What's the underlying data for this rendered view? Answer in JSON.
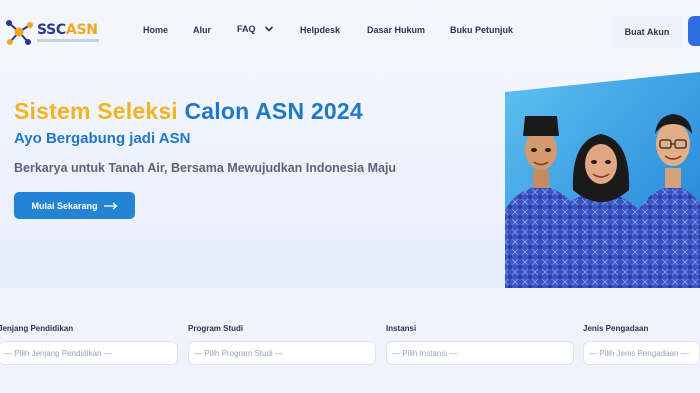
{
  "brand": {
    "ssc": "SSC",
    "asn": "ASN"
  },
  "nav": {
    "home": "Home",
    "alur": "Alur",
    "faq": "FAQ",
    "helpdesk": "Helpdesk",
    "dasar_hukum": "Dasar Hukum",
    "buku_petunjuk": "Buku Petunjuk",
    "buat_akun": "Buat Akun"
  },
  "hero": {
    "title_part1": "Sistem Seleksi",
    "title_part2": "Calon ASN 2024",
    "subtitle": "Ayo Bergabung jadi ASN",
    "tagline": "Berkarya untuk Tanah Air, Bersama Mewujudkan Indonesia Maju",
    "cta": "Mulai Sekarang"
  },
  "filters": [
    {
      "label": "Jenjang Pendidikan",
      "placeholder": "— Pilih Jenjang Pendidikan —"
    },
    {
      "label": "Program Studi",
      "placeholder": "— Pilih Program Studi —"
    },
    {
      "label": "Instansi",
      "placeholder": "— Pilih Instansi —"
    },
    {
      "label": "Jenis Pengadaan",
      "placeholder": "— Pilih Jenis Pengadaan —"
    }
  ],
  "colors": {
    "accent_blue": "#1f78c8",
    "accent_yellow": "#f2b325",
    "button_blue": "#2384d6",
    "batik_blue": "#3a55c4"
  },
  "icons": {
    "logo": "network-logo-icon",
    "faq_dropdown": "chevron-down-icon",
    "cta_arrow": "arrow-right-icon"
  }
}
